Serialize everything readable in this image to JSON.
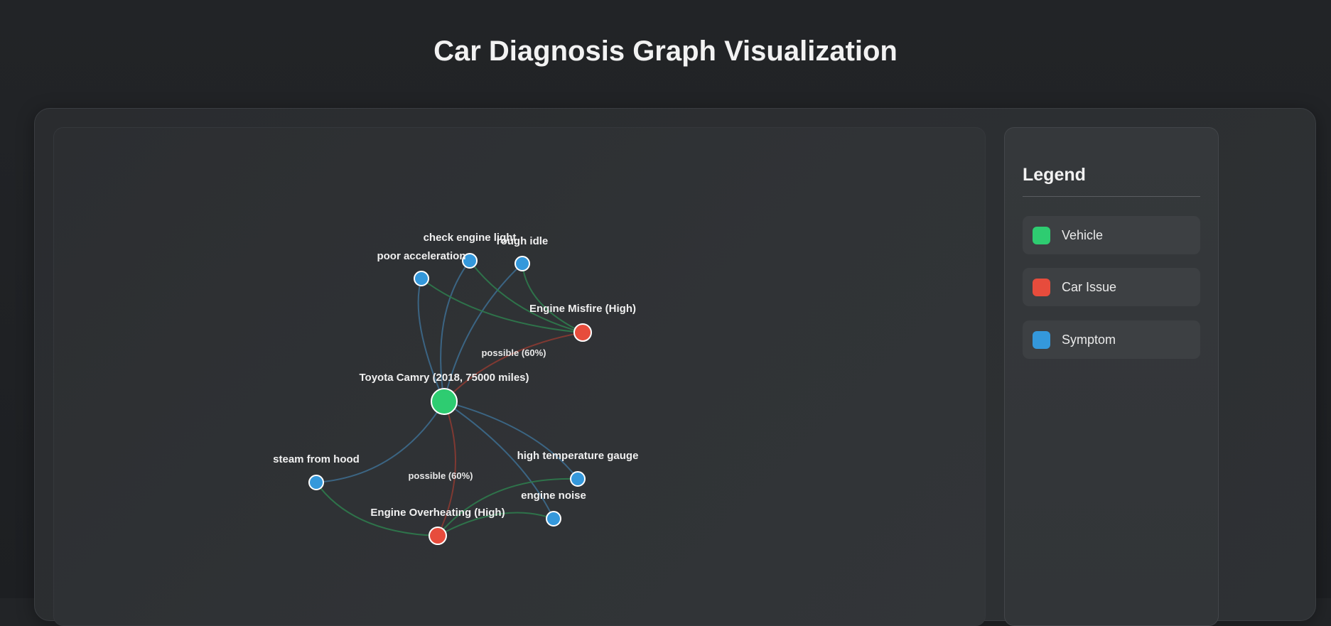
{
  "page": {
    "title": "Car Diagnosis Graph Visualization"
  },
  "legend": {
    "title": "Legend",
    "items": [
      {
        "label": "Vehicle",
        "color": "#2ecc71"
      },
      {
        "label": "Car Issue",
        "color": "#e74c3c"
      },
      {
        "label": "Symptom",
        "color": "#3498db"
      }
    ]
  },
  "graph": {
    "colors": {
      "vehicle": "#2ecc71",
      "issue": "#e74c3c",
      "symptom": "#3498db",
      "edge_vehicle_symptom": "#3d6a8c",
      "edge_issue_symptom": "#2f7a4c",
      "edge_vehicle_issue": "#8a3a32"
    },
    "nodes": [
      {
        "id": "vehicle",
        "type": "vehicle",
        "label": "Toyota Camry (2018, 75000 miles)"
      },
      {
        "id": "misfire",
        "type": "issue",
        "label": "Engine Misfire (High)"
      },
      {
        "id": "overheat",
        "type": "issue",
        "label": "Engine Overheating (High)"
      },
      {
        "id": "check_engine",
        "type": "symptom",
        "label": "check engine light"
      },
      {
        "id": "rough_idle",
        "type": "symptom",
        "label": "rough idle"
      },
      {
        "id": "poor_accel",
        "type": "symptom",
        "label": "poor acceleration"
      },
      {
        "id": "steam",
        "type": "symptom",
        "label": "steam from hood"
      },
      {
        "id": "high_temp",
        "type": "symptom",
        "label": "high temperature gauge"
      },
      {
        "id": "engine_noise",
        "type": "symptom",
        "label": "engine noise"
      }
    ],
    "edges": [
      {
        "from": "vehicle",
        "to": "misfire",
        "kind": "vehicle_issue",
        "label": "possible (60%)"
      },
      {
        "from": "vehicle",
        "to": "overheat",
        "kind": "vehicle_issue",
        "label": "possible (60%)"
      },
      {
        "from": "vehicle",
        "to": "check_engine",
        "kind": "vehicle_symptom",
        "label": ""
      },
      {
        "from": "vehicle",
        "to": "rough_idle",
        "kind": "vehicle_symptom",
        "label": ""
      },
      {
        "from": "vehicle",
        "to": "poor_accel",
        "kind": "vehicle_symptom",
        "label": ""
      },
      {
        "from": "vehicle",
        "to": "steam",
        "kind": "vehicle_symptom",
        "label": ""
      },
      {
        "from": "vehicle",
        "to": "high_temp",
        "kind": "vehicle_symptom",
        "label": ""
      },
      {
        "from": "vehicle",
        "to": "engine_noise",
        "kind": "vehicle_symptom",
        "label": ""
      },
      {
        "from": "misfire",
        "to": "check_engine",
        "kind": "issue_symptom",
        "label": ""
      },
      {
        "from": "misfire",
        "to": "rough_idle",
        "kind": "issue_symptom",
        "label": ""
      },
      {
        "from": "misfire",
        "to": "poor_accel",
        "kind": "issue_symptom",
        "label": ""
      },
      {
        "from": "overheat",
        "to": "steam",
        "kind": "issue_symptom",
        "label": ""
      },
      {
        "from": "overheat",
        "to": "high_temp",
        "kind": "issue_symptom",
        "label": ""
      },
      {
        "from": "overheat",
        "to": "engine_noise",
        "kind": "issue_symptom",
        "label": ""
      }
    ]
  }
}
